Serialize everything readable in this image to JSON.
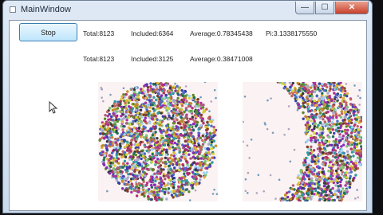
{
  "window": {
    "title": "MainWindow"
  },
  "controls": {
    "minimize": "—",
    "maximize": "☐",
    "close": "✕"
  },
  "toolbar": {
    "stop_label": "Stop"
  },
  "stats": [
    {
      "total": "Total:8123",
      "included": "Included:6364",
      "average": "Average:0.78345438",
      "pi": "Pi:3.1338175550"
    },
    {
      "total": "Total:8123",
      "included": "Included:3125",
      "average": "Average:0.38471008"
    }
  ],
  "colors": {
    "plot_background": "#fbf3f3",
    "dots": [
      "#3a3fae",
      "#5b8a2c",
      "#b02e9c",
      "#c58a25",
      "#2d9aa1",
      "#7d3b2b",
      "#a9a9cf",
      "#4a6cc7",
      "#b3306c",
      "#333a3d",
      "#e2b13b",
      "#7cc27a",
      "#1f6f5a",
      "#d3d33a",
      "#8a2ab8",
      "#ae5a7b",
      "#9fd3f1",
      "#c6675a"
    ],
    "sparse_dots": [
      "#7d9ab6",
      "#a4a8ba",
      "#6aa0c2",
      "#b6a2c4"
    ]
  },
  "icons": {
    "cursor": "mouse-pointer-icon",
    "app": "window-app-icon"
  }
}
